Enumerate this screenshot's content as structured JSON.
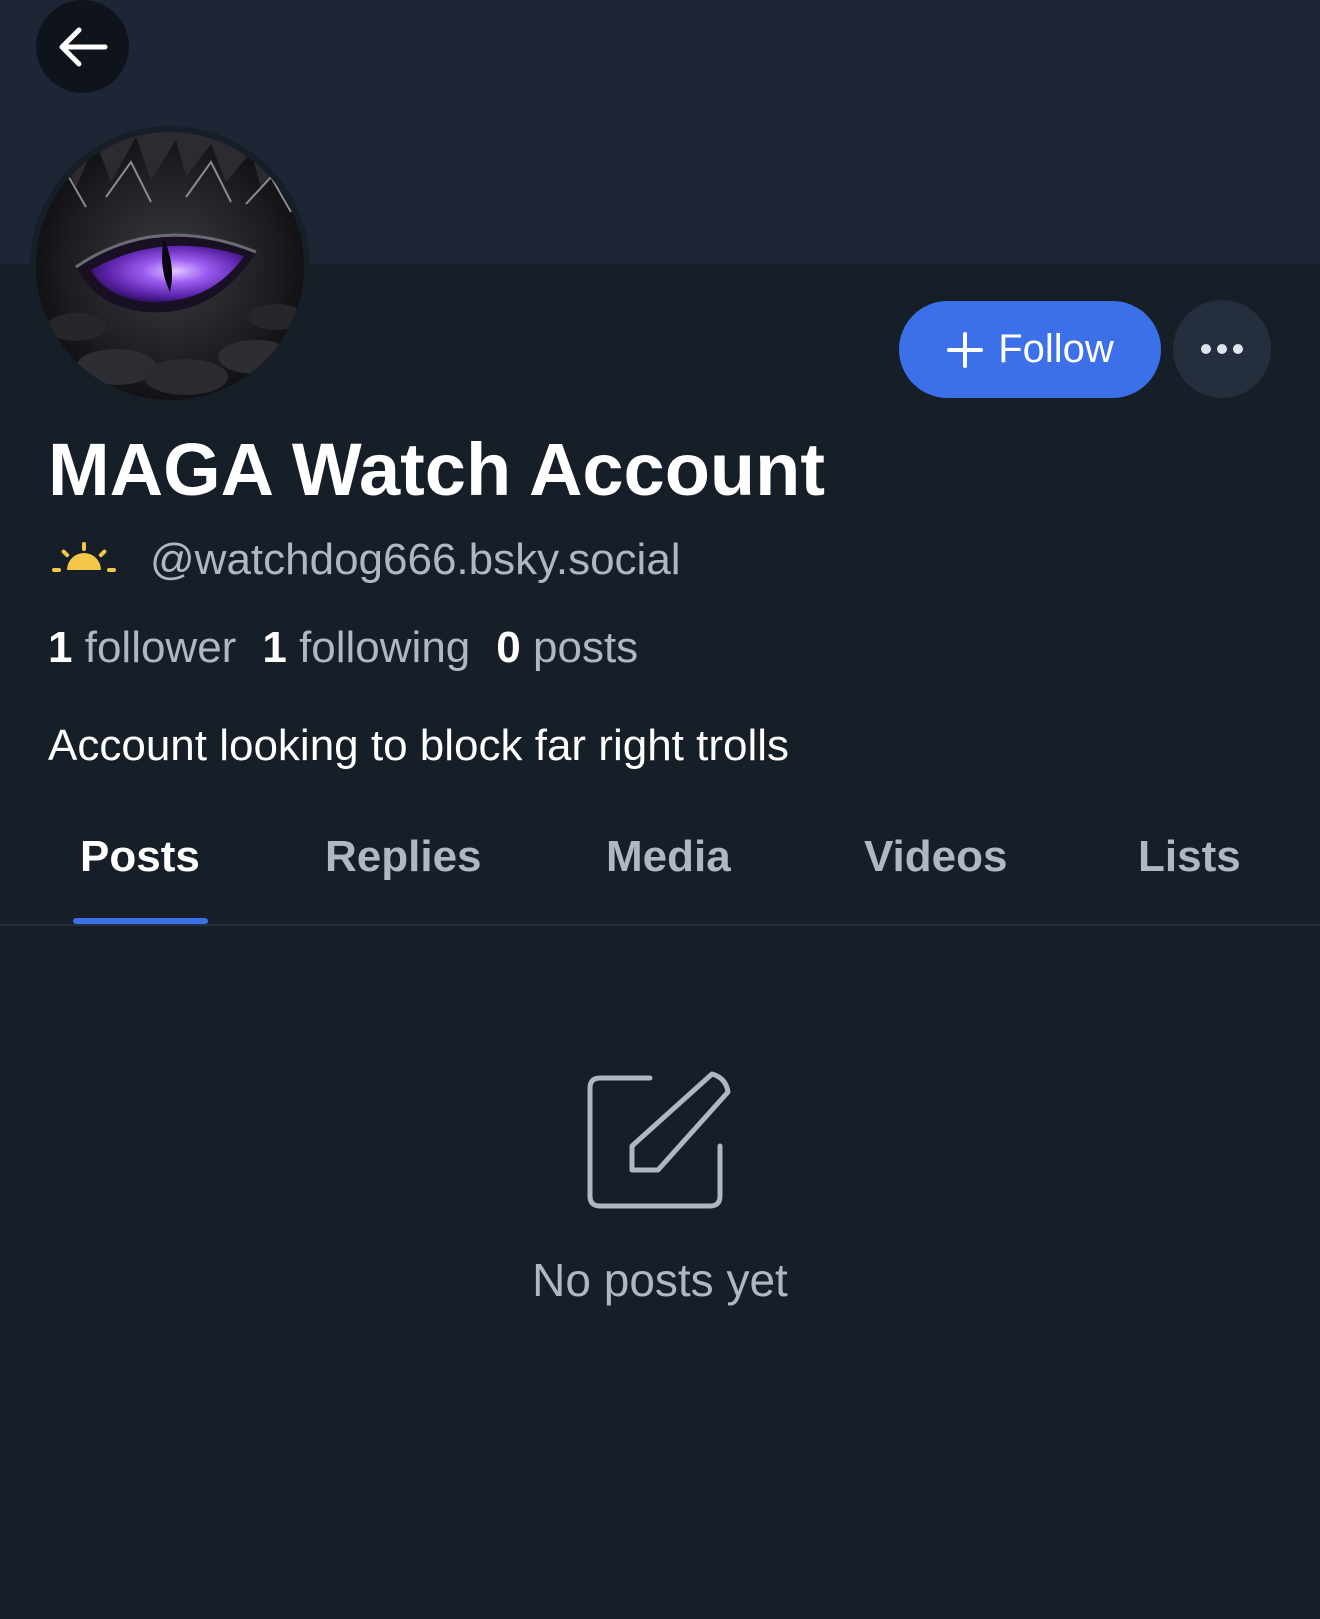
{
  "profile": {
    "display_name": "MAGA Watch Account",
    "handle": "@watchdog666.bsky.social",
    "bio": "Account looking to block far right trolls",
    "avatar": "dragon-eye-avatar",
    "badge_icon": "sunrise-icon",
    "stats": {
      "followers_count": "1",
      "followers_label": "follower",
      "following_count": "1",
      "following_label": "following",
      "posts_count": "0",
      "posts_label": "posts"
    }
  },
  "actions": {
    "follow_label": "Follow",
    "follow_icon": "plus-icon",
    "more_icon": "ellipsis-icon",
    "back_icon": "arrow-left-icon"
  },
  "tabs": [
    {
      "label": "Posts",
      "active": true
    },
    {
      "label": "Replies",
      "active": false
    },
    {
      "label": "Media",
      "active": false
    },
    {
      "label": "Videos",
      "active": false
    },
    {
      "label": "Lists",
      "active": false
    }
  ],
  "empty_state": {
    "icon": "edit-icon",
    "text": "No posts yet"
  },
  "colors": {
    "background": "#161e27",
    "banner": "#1e2635",
    "accent": "#3b70e8",
    "muted_text": "#aeb7c4",
    "badge": "#f4c64a"
  }
}
